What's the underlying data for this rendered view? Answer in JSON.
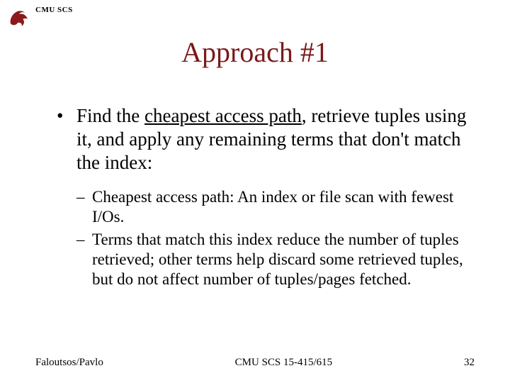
{
  "header": {
    "org": "CMU SCS"
  },
  "title": "Approach #1",
  "main_bullet": {
    "pre": "Find the ",
    "underlined": "cheapest access path",
    "post": ", retrieve tuples using it, and apply any remaining terms that don't match the index:"
  },
  "sub_bullets": [
    "Cheapest access path: An index or file scan with fewest I/Os.",
    "Terms that match this index reduce the number of tuples retrieved; other terms help discard some retrieved tuples, but do not affect number of tuples/pages fetched."
  ],
  "footer": {
    "left": "Faloutsos/Pavlo",
    "center": "CMU SCS 15-415/615",
    "right": "32"
  }
}
